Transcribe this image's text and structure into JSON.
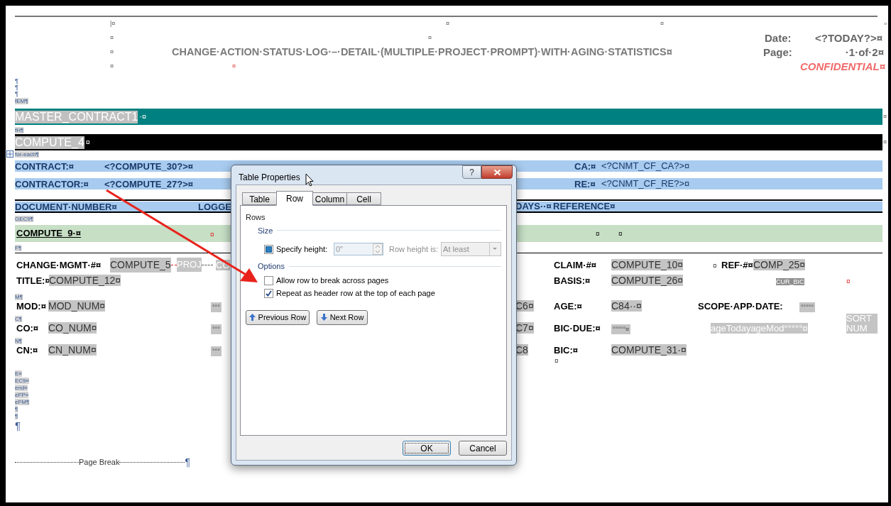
{
  "header": {
    "side_marks": [
      "|¤",
      "¤",
      "¤",
      "¤"
    ],
    "top_marks": [
      "¤",
      "¤",
      "¤"
    ],
    "mid_mark": "¤",
    "title": "CHANGE·ACTION·STATUS·LOG·–·DETAIL·(MULTIPLE·PROJECT·PROMPT)·WITH·AGING·STATISTICS¤",
    "red_mark": "¤",
    "date_label": "Date:",
    "date_value": "<?TODAY?>¤",
    "page_label": "Page:",
    "page_value": "·1·of·2¤",
    "confidential": "CONFIDENTIAL¤"
  },
  "pilcrows": [
    "¶",
    "¶",
    "¶"
  ],
  "tag_before_master": "fEM¶",
  "master_band": {
    "text": "MASTER_CONTRACT1",
    "suffix": "·¤",
    "end_mark": "¤"
  },
  "tag_before_compute": "fH¶",
  "compute_band": {
    "text": "COMPUTE_4",
    "suffix": "¤",
    "end_mark": "¤"
  },
  "tag_for_each": "for-each¶",
  "info_rows": [
    {
      "label": "CONTRACT:¤",
      "value": "<?COMPUTE_30?>¤",
      "label2": "CA:¤",
      "value2": "<?CNMT_CF_CA?>¤"
    },
    {
      "label": "CONTRACTOR:¤",
      "value": "<?COMPUTE_27?>¤",
      "label2": "RE:¤",
      "value2": "<?CNMT_CF_RE?>¤"
    }
  ],
  "column_headers": [
    "DOCUMENT·NUMBER¤",
    "LOGGE",
    "DAYS··¤",
    "REFERENCE¤"
  ],
  "tag_before_group": "GEC9¶",
  "group_band": {
    "text": "COMPUTE_9·¤",
    "marks": [
      "¤",
      "¤",
      "¤"
    ]
  },
  "tag_after_group": "F¶",
  "detail_lines": [
    {
      "left": [
        {
          "kind": "label",
          "text": "CHANGE·MGMT·#¤"
        },
        {
          "kind": "field",
          "text": "COMPUTE_5"
        },
        {
          "kind": "ghost",
          "text": "PROJ"
        },
        {
          "kind": "ghost",
          "text": "CO"
        }
      ],
      "right": [
        {
          "kind": "label",
          "text": "CLAIM·#¤"
        },
        {
          "kind": "field",
          "text": "COMPUTE_10¤"
        },
        {
          "kind": "mark",
          "text": "¤"
        },
        {
          "kind": "label",
          "text": "REF·#¤"
        },
        {
          "kind": "field",
          "text": "COMP_25¤"
        }
      ]
    },
    {
      "left": [
        {
          "kind": "label",
          "text": "TITLE:¤"
        },
        {
          "kind": "field",
          "text": "COMPUTE_12¤"
        }
      ],
      "right": [
        {
          "kind": "label",
          "text": "BASIS:¤"
        },
        {
          "kind": "field",
          "text": "COMPUTE_26¤"
        },
        {
          "kind": "tiny",
          "text": "CUR_BIC"
        },
        {
          "kind": "alert",
          "text": "¤"
        }
      ]
    },
    {
      "tag": "M¶",
      "left": [
        {
          "kind": "label",
          "text": "MOD:¤"
        },
        {
          "kind": "field",
          "text": "MOD_NUM¤"
        },
        {
          "kind": "dots",
          "text": "°°°"
        }
      ],
      "right": [
        {
          "kind": "field",
          "text": "C6¤"
        },
        {
          "kind": "label",
          "text": "AGE:¤"
        },
        {
          "kind": "field",
          "text": "C84··¤"
        },
        {
          "kind": "label",
          "text": "SCOPE·APP·DATE:"
        },
        {
          "kind": "dots",
          "text": "°°°°°"
        }
      ]
    },
    {
      "tag": "C¶",
      "left": [
        {
          "kind": "label",
          "text": "CO:¤"
        },
        {
          "kind": "field",
          "text": "CO_NUM¤"
        },
        {
          "kind": "dots",
          "text": "°°°"
        }
      ],
      "right": [
        {
          "kind": "field",
          "text": "C7¤"
        },
        {
          "kind": "label",
          "text": "BIC·DUE:¤"
        },
        {
          "kind": "dots",
          "text": "°°°°°¤"
        },
        {
          "kind": "ghost",
          "text": "ageTodayageMod°°°°°¤"
        },
        {
          "kind": "wrap",
          "text": "SORT NUM"
        }
      ]
    },
    {
      "tag": "N¶",
      "left": [
        {
          "kind": "label",
          "text": "CN:¤"
        },
        {
          "kind": "field",
          "text": "CN_NUM¤"
        },
        {
          "kind": "dots",
          "text": "°°°"
        }
      ],
      "right": [
        {
          "kind": "field",
          "text": "C8"
        },
        {
          "kind": "label",
          "text": "BIC:¤"
        },
        {
          "kind": "field",
          "text": "COMPUTE_31·¤"
        }
      ]
    },
    {
      "right": [
        {
          "kind": "mark",
          "text": "¤"
        }
      ]
    }
  ],
  "tail_tags": [
    "E¤",
    "EC9¤",
    "end¤",
    "eFP¤",
    "eFM¶",
    "¶",
    "¶"
  ],
  "tail_pilcrow": "¶",
  "page_break": {
    "text": "Page Break",
    "mark": "¶"
  },
  "dialog": {
    "title": "Table Properties",
    "help": "?",
    "tabs": [
      {
        "label": "Table",
        "selected": false
      },
      {
        "label": "Row",
        "selected": true
      },
      {
        "label": "Column",
        "selected": false
      },
      {
        "label": "Cell",
        "selected": false
      }
    ],
    "section": "Rows",
    "size_heading": "Size",
    "specify_height": {
      "label": "Specify height:",
      "indeterminate": true
    },
    "height_field": {
      "value": "0\"",
      "disabled": true
    },
    "row_height_label": {
      "text": "Row height is:",
      "disabled": true
    },
    "row_height_select": {
      "value": "At least",
      "disabled": true
    },
    "options_heading": "Options",
    "options": [
      {
        "label": "Allow row to break across pages",
        "checked": false
      },
      {
        "label": "Repeat as header row at the top of each page",
        "checked": true
      }
    ],
    "nav_buttons": [
      "Previous Row",
      "Next Row"
    ],
    "ok": "OK",
    "cancel": "Cancel"
  }
}
